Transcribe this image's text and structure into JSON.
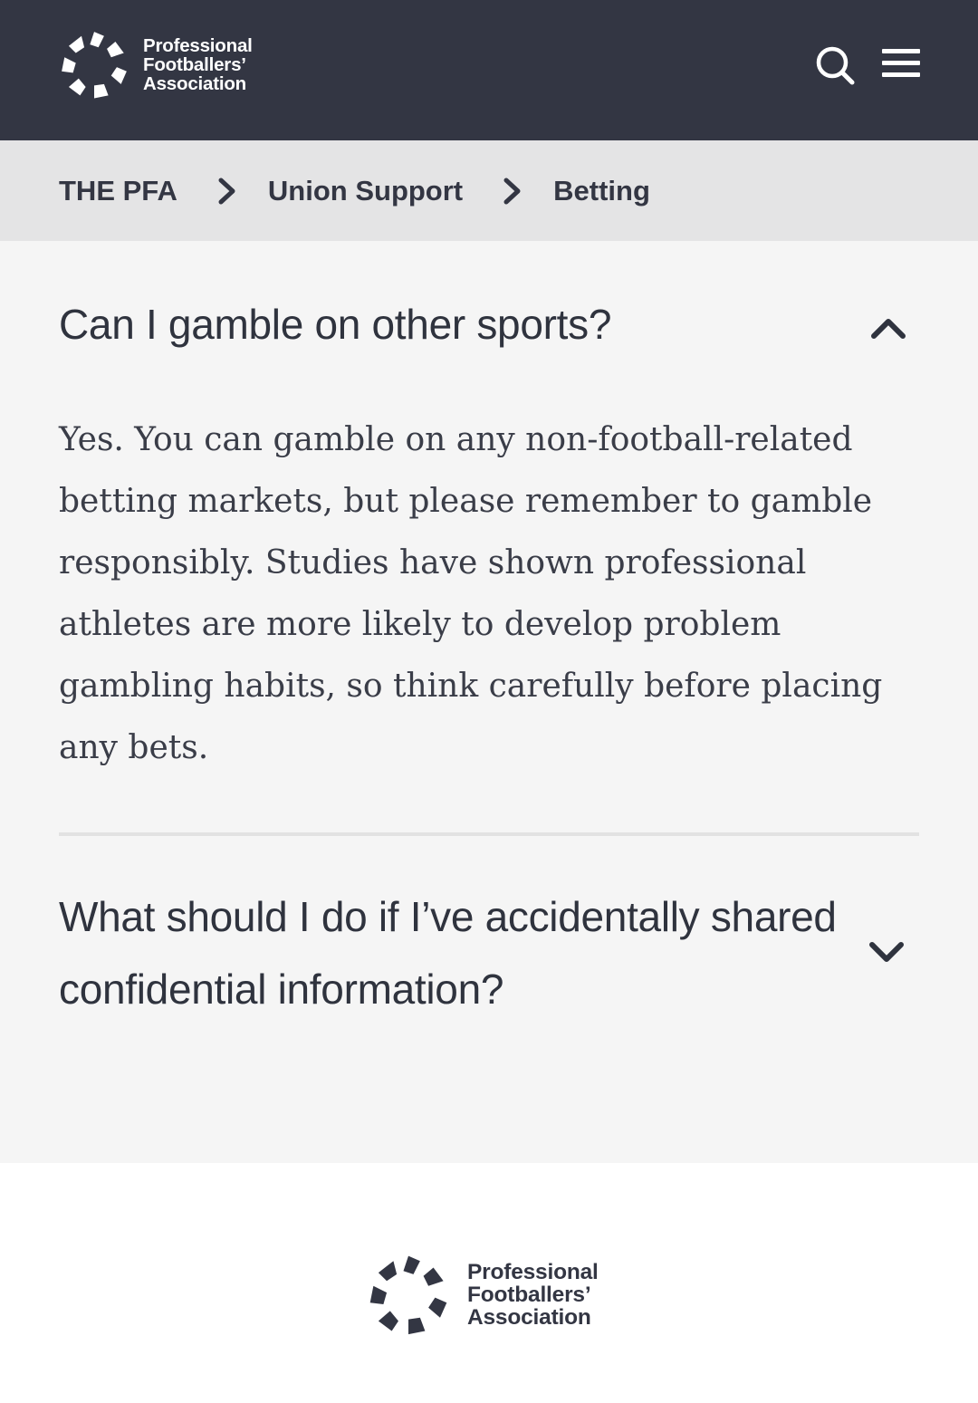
{
  "header": {
    "logo_lines": [
      "Professional",
      "Footballers’",
      "Association"
    ],
    "icons": [
      "pfa-logo-icon",
      "search-icon",
      "menu-icon"
    ]
  },
  "breadcrumb": {
    "items": [
      "THE PFA",
      "Union Support",
      "Betting"
    ]
  },
  "faq": {
    "items": [
      {
        "question": "Can I gamble on other sports?",
        "expanded": true,
        "answer": "Yes. You can gamble on any non-football-related betting markets, but please remember to gamble responsibly. Studies have shown professional athletes are more likely to develop problem gambling habits, so think carefully before placing any bets."
      },
      {
        "question": "What should I do if I’ve accidentally shared confidential information?",
        "expanded": false
      }
    ]
  },
  "footer": {
    "logo_lines": [
      "Professional",
      "Footballers’",
      "Association"
    ]
  },
  "colors": {
    "header_bg": "#333643",
    "breadcrumb_bg": "#e4e4e5",
    "content_bg": "#f5f5f5",
    "text": "#2f333e"
  }
}
